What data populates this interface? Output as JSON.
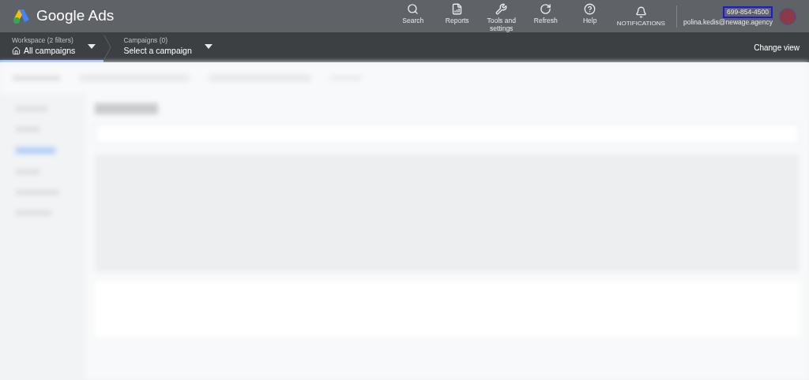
{
  "header": {
    "product": "Google Ads",
    "actions": [
      {
        "label": "Search",
        "kind": "regular"
      },
      {
        "label": "Reports",
        "kind": "regular"
      },
      {
        "label": "Tools and settings",
        "kind": "regular"
      },
      {
        "label": "Refresh",
        "kind": "regular"
      },
      {
        "label": "Help",
        "kind": "regular"
      },
      {
        "label": "NOTIFICATIONS",
        "kind": "compact"
      }
    ],
    "account": {
      "customer_id": "699-854-4500",
      "highlighted": true,
      "email": "polina.kedis@newage.agency"
    }
  },
  "nav": {
    "selectors": [
      {
        "caption": "Workspace (2 filters)",
        "value": "All campaigns",
        "selected": true
      },
      {
        "caption": "Campaigns (0)",
        "value": "Select a campaign",
        "selected": false
      }
    ],
    "change_view": "Change view"
  }
}
